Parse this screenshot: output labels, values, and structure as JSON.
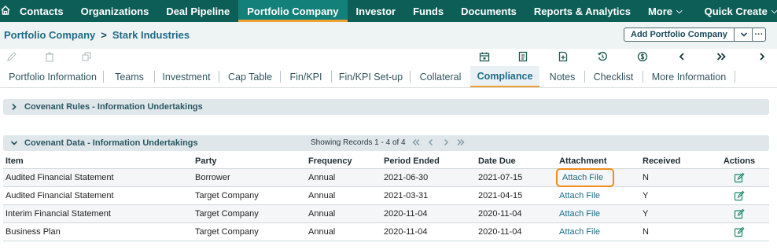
{
  "nav": {
    "home_icon": "home-icon",
    "items": [
      {
        "label": "Contacts"
      },
      {
        "label": "Organizations"
      },
      {
        "label": "Deal Pipeline"
      },
      {
        "label": "Portfolio Company",
        "active": true
      },
      {
        "label": "Investor"
      },
      {
        "label": "Funds"
      },
      {
        "label": "Documents"
      },
      {
        "label": "Reports & Analytics"
      },
      {
        "label": "More"
      },
      {
        "label": "Quick Create"
      }
    ]
  },
  "breadcrumb": {
    "root": "Portfolio Company",
    "separator": ">",
    "current": "Stark Industries"
  },
  "actions": {
    "add_label": "Add Portfolio Company",
    "more_label": "···"
  },
  "toolbar": {
    "left_icons": [
      "edit-icon",
      "trash-icon",
      "copy-icon"
    ],
    "right_icons": [
      "calendar-icon",
      "document-icon",
      "add-document-icon",
      "history-icon",
      "currency-icon",
      "chevron-left-icon",
      "double-chevron-right-icon",
      "chevron-right-icon"
    ]
  },
  "tabs": [
    {
      "label": "Portfolio Information"
    },
    {
      "label": "Teams"
    },
    {
      "label": "Investment"
    },
    {
      "label": "Cap Table"
    },
    {
      "label": "Fin/KPI"
    },
    {
      "label": "Fin/KPI Set-up"
    },
    {
      "label": "Collateral"
    },
    {
      "label": "Compliance",
      "active": true
    },
    {
      "label": "Notes"
    },
    {
      "label": "Checklist"
    },
    {
      "label": "More Information"
    }
  ],
  "sections": {
    "covenant_rules": {
      "title": "Covenant Rules - Information Undertakings"
    },
    "covenant_data": {
      "title": "Covenant Data - Information Undertakings",
      "paging_text": "Showing Records 1 - 4 of 4"
    }
  },
  "table": {
    "columns": [
      "Item",
      "Party",
      "Frequency",
      "Period Ended",
      "Date Due",
      "Attachment",
      "Received",
      "Actions"
    ],
    "rows": [
      {
        "item": "Audited Financial Statement",
        "party": "Borrower",
        "frequency": "Annual",
        "period_ended": "2021-06-30",
        "date_due": "2021-07-15",
        "attachment": "Attach File",
        "received": "N"
      },
      {
        "item": "Audited Financial Statement",
        "party": "Target Company",
        "frequency": "Annual",
        "period_ended": "2021-03-31",
        "date_due": "2021-04-15",
        "attachment": "Attach File",
        "received": "Y"
      },
      {
        "item": "Interim Financial Statement",
        "party": "Target Company",
        "frequency": "Annual",
        "period_ended": "2020-11-04",
        "date_due": "2020-11-04",
        "attachment": "Attach File",
        "received": "Y"
      },
      {
        "item": "Business Plan",
        "party": "Target Company",
        "frequency": "Annual",
        "period_ended": "2020-11-04",
        "date_due": "2020-11-04",
        "attachment": "Attach File",
        "received": "N"
      }
    ]
  },
  "colors": {
    "nav_bg": "#0d5e57",
    "nav_active": "#13807a",
    "accent": "#f0a030",
    "link": "#1f6c88",
    "highlight": "#f08c1a"
  }
}
